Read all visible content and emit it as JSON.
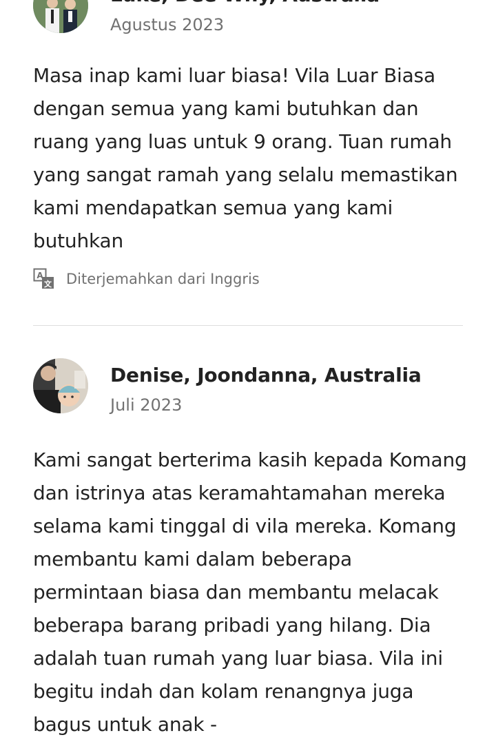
{
  "reviews": [
    {
      "reviewer": "Luke, Dee Why, Australia",
      "date": "Agustus 2023",
      "text": "Masa inap kami luar biasa! Vila Luar Biasa dengan semua yang kami butuhkan dan ruang yang luas untuk 9 orang. Tuan rumah yang sangat ramah yang selalu memastikan kami mendapatkan semua yang kami butuhkan",
      "translation_note": "Diterjemahkan dari Inggris"
    },
    {
      "reviewer": "Denise, Joondanna, Australia",
      "date": "Juli 2023",
      "text": "Kami sangat berterima kasih kepada Komang dan istrinya atas keramahtamahan mereka selama kami tinggal di vila mereka. Komang membantu kami dalam beberapa permintaan biasa dan membantu melacak beberapa barang pribadi yang hilang. Dia adalah tuan rumah yang luar biasa. Vila ini begitu indah dan kolam renangnya juga bagus untuk anak -"
    }
  ],
  "icons": {
    "translate": "translate-icon"
  }
}
